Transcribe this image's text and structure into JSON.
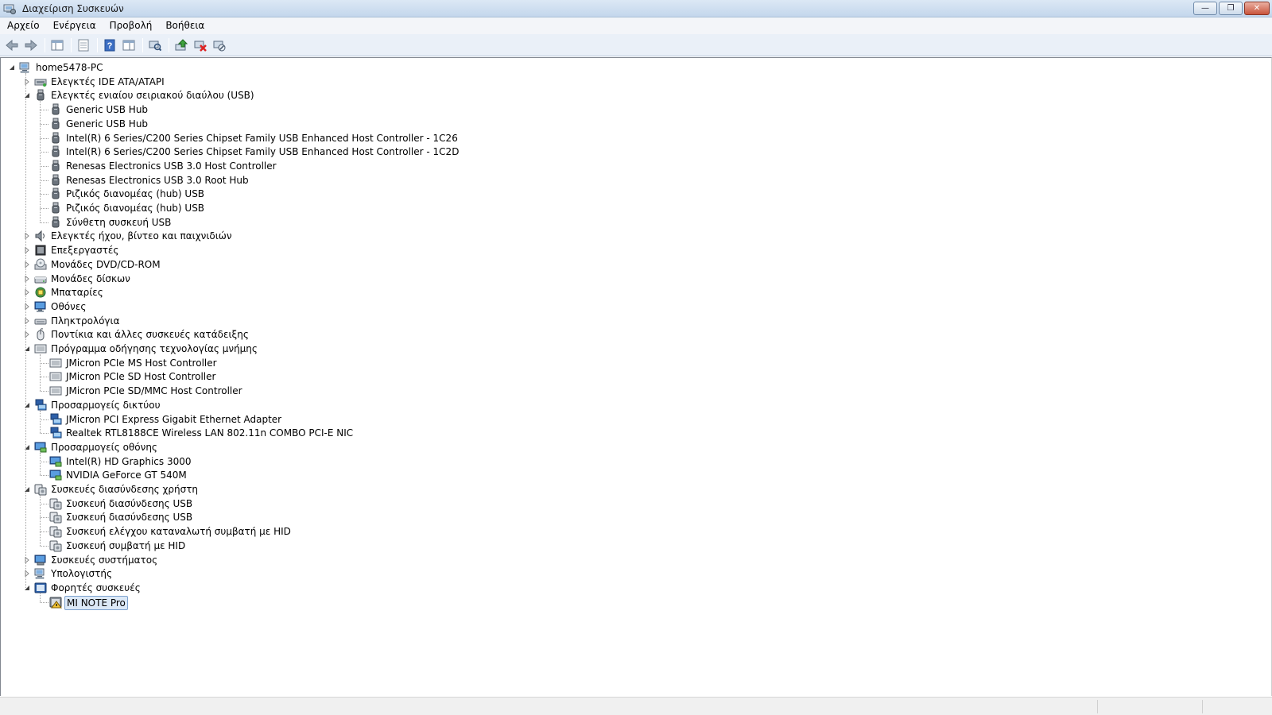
{
  "window": {
    "title": "Διαχείριση Συσκευών"
  },
  "window_controls": {
    "minimize": "—",
    "maximize": "❐",
    "close": "✕"
  },
  "menu": [
    "Αρχείο",
    "Ενέργεια",
    "Προβολή",
    "Βοήθεια"
  ],
  "toolbar": [
    "back",
    "forward",
    "show-hide-console-tree",
    "properties",
    "help",
    "details-view",
    "scan-for-hardware-changes",
    "update-driver",
    "uninstall",
    "disable"
  ],
  "tree": {
    "root": "home5478-PC",
    "categories": [
      {
        "label": "Ελεγκτές IDE ATA/ATAPI",
        "icon": "ide-icon",
        "expanded": false,
        "children": []
      },
      {
        "label": "Ελεγκτές ενιαίου σειριακού διαύλου (USB)",
        "icon": "usb-icon",
        "expanded": true,
        "children": [
          {
            "label": "Generic USB Hub",
            "icon": "usb-icon"
          },
          {
            "label": "Generic USB Hub",
            "icon": "usb-icon"
          },
          {
            "label": "Intel(R) 6 Series/C200 Series Chipset Family USB Enhanced Host Controller - 1C26",
            "icon": "usb-icon"
          },
          {
            "label": "Intel(R) 6 Series/C200 Series Chipset Family USB Enhanced Host Controller - 1C2D",
            "icon": "usb-icon"
          },
          {
            "label": "Renesas Electronics USB 3.0 Host Controller",
            "icon": "usb-icon"
          },
          {
            "label": "Renesas Electronics USB 3.0 Root Hub",
            "icon": "usb-icon"
          },
          {
            "label": "Ριζικός διανομέας (hub) USB",
            "icon": "usb-icon"
          },
          {
            "label": "Ριζικός διανομέας (hub) USB",
            "icon": "usb-icon"
          },
          {
            "label": "Σύνθετη συσκευή USB",
            "icon": "usb-icon"
          }
        ]
      },
      {
        "label": "Ελεγκτές ήχου, βίντεο και παιχνιδιών",
        "icon": "speaker-icon",
        "expanded": false,
        "children": []
      },
      {
        "label": "Επεξεργαστές",
        "icon": "cpu-icon",
        "expanded": false,
        "children": []
      },
      {
        "label": "Μονάδες DVD/CD-ROM",
        "icon": "dvd-icon",
        "expanded": false,
        "children": []
      },
      {
        "label": "Μονάδες δίσκων",
        "icon": "disk-icon",
        "expanded": false,
        "children": []
      },
      {
        "label": "Μπαταρίες",
        "icon": "battery-icon",
        "expanded": false,
        "children": []
      },
      {
        "label": "Οθόνες",
        "icon": "monitor-icon",
        "expanded": false,
        "children": []
      },
      {
        "label": "Πληκτρολόγια",
        "icon": "keyboard-icon",
        "expanded": false,
        "children": []
      },
      {
        "label": "Ποντίκια και άλλες συσκευές κατάδειξης",
        "icon": "mouse-icon",
        "expanded": false,
        "children": []
      },
      {
        "label": "Πρόγραμμα οδήγησης τεχνολογίας μνήμης",
        "icon": "memory-card-icon",
        "expanded": true,
        "children": [
          {
            "label": "JMicron PCIe MS Host Controller",
            "icon": "memory-card-icon"
          },
          {
            "label": "JMicron PCIe SD Host Controller",
            "icon": "memory-card-icon"
          },
          {
            "label": "JMicron PCIe SD/MMC Host Controller",
            "icon": "memory-card-icon"
          }
        ]
      },
      {
        "label": "Προσαρμογείς δικτύου",
        "icon": "network-icon",
        "expanded": true,
        "children": [
          {
            "label": "JMicron PCI Express Gigabit Ethernet Adapter",
            "icon": "network-icon"
          },
          {
            "label": "Realtek RTL8188CE Wireless LAN 802.11n COMBO PCI-E NIC",
            "icon": "network-icon"
          }
        ]
      },
      {
        "label": "Προσαρμογείς οθόνης",
        "icon": "display-adapter-icon",
        "expanded": true,
        "children": [
          {
            "label": "Intel(R) HD Graphics 3000",
            "icon": "display-adapter-icon"
          },
          {
            "label": "NVIDIA GeForce GT 540M",
            "icon": "display-adapter-icon"
          }
        ]
      },
      {
        "label": "Συσκευές διασύνδεσης χρήστη",
        "icon": "hid-icon",
        "expanded": true,
        "children": [
          {
            "label": "Συσκευή διασύνδεσης USB",
            "icon": "hid-icon"
          },
          {
            "label": "Συσκευή διασύνδεσης USB",
            "icon": "hid-icon"
          },
          {
            "label": "Συσκευή ελέγχου καταναλωτή συμβατή με HID",
            "icon": "hid-icon"
          },
          {
            "label": "Συσκευή συμβατή με HID",
            "icon": "hid-icon"
          }
        ]
      },
      {
        "label": "Συσκευές συστήματος",
        "icon": "system-icon",
        "expanded": false,
        "children": []
      },
      {
        "label": "Υπολογιστής",
        "icon": "computer-icon",
        "expanded": false,
        "children": []
      },
      {
        "label": "Φορητές συσκευές",
        "icon": "portable-device-icon",
        "expanded": true,
        "children": [
          {
            "label": "MI NOTE Pro",
            "icon": "warning-device-icon",
            "selected": true
          }
        ]
      }
    ]
  }
}
